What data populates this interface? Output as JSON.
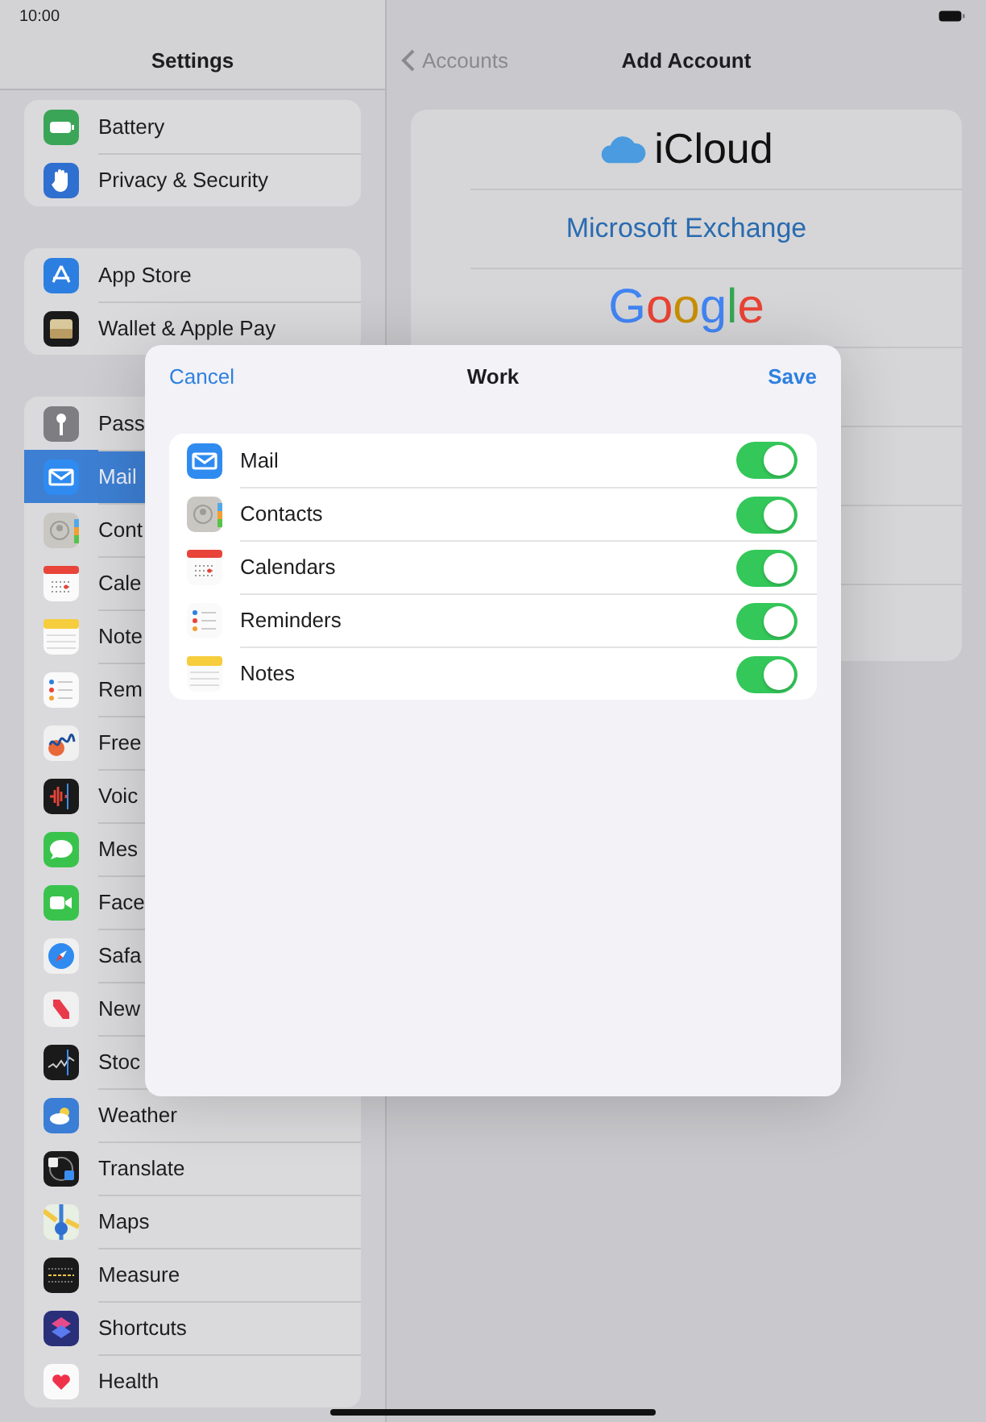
{
  "status_bar": {
    "time": "10:00"
  },
  "sidebar": {
    "title": "Settings",
    "groups": [
      {
        "items": [
          {
            "label": "Battery",
            "selected": false
          },
          {
            "label": "Privacy & Security",
            "selected": false
          }
        ]
      },
      {
        "items": [
          {
            "label": "App Store",
            "selected": false
          },
          {
            "label": "Wallet & Apple Pay",
            "selected": false
          }
        ]
      },
      {
        "items": [
          {
            "label": "Pass",
            "selected": false
          },
          {
            "label": "Mail",
            "selected": true
          },
          {
            "label": "Cont",
            "selected": false
          },
          {
            "label": "Cale",
            "selected": false
          },
          {
            "label": "Note",
            "selected": false
          },
          {
            "label": "Rem",
            "selected": false
          },
          {
            "label": "Free",
            "selected": false
          },
          {
            "label": "Voic",
            "selected": false
          },
          {
            "label": "Mes",
            "selected": false
          },
          {
            "label": "Face",
            "selected": false
          },
          {
            "label": "Safa",
            "selected": false
          },
          {
            "label": "New",
            "selected": false
          },
          {
            "label": "Stoc",
            "selected": false
          },
          {
            "label": "Weather",
            "selected": false
          },
          {
            "label": "Translate",
            "selected": false
          },
          {
            "label": "Maps",
            "selected": false
          },
          {
            "label": "Measure",
            "selected": false
          },
          {
            "label": "Shortcuts",
            "selected": false
          },
          {
            "label": "Health",
            "selected": false
          }
        ]
      }
    ]
  },
  "detail": {
    "back": "Accounts",
    "title": "Add Account",
    "providers": [
      {
        "kind": "icloud",
        "label": "iCloud"
      },
      {
        "kind": "exchange",
        "label": "Microsoft Exchange"
      },
      {
        "kind": "google",
        "label": "Google"
      }
    ]
  },
  "sheet": {
    "cancel": "Cancel",
    "title": "Work",
    "save": "Save",
    "items": [
      {
        "label": "Mail",
        "on": true
      },
      {
        "label": "Contacts",
        "on": true
      },
      {
        "label": "Calendars",
        "on": true
      },
      {
        "label": "Reminders",
        "on": true
      },
      {
        "label": "Notes",
        "on": true
      }
    ]
  }
}
